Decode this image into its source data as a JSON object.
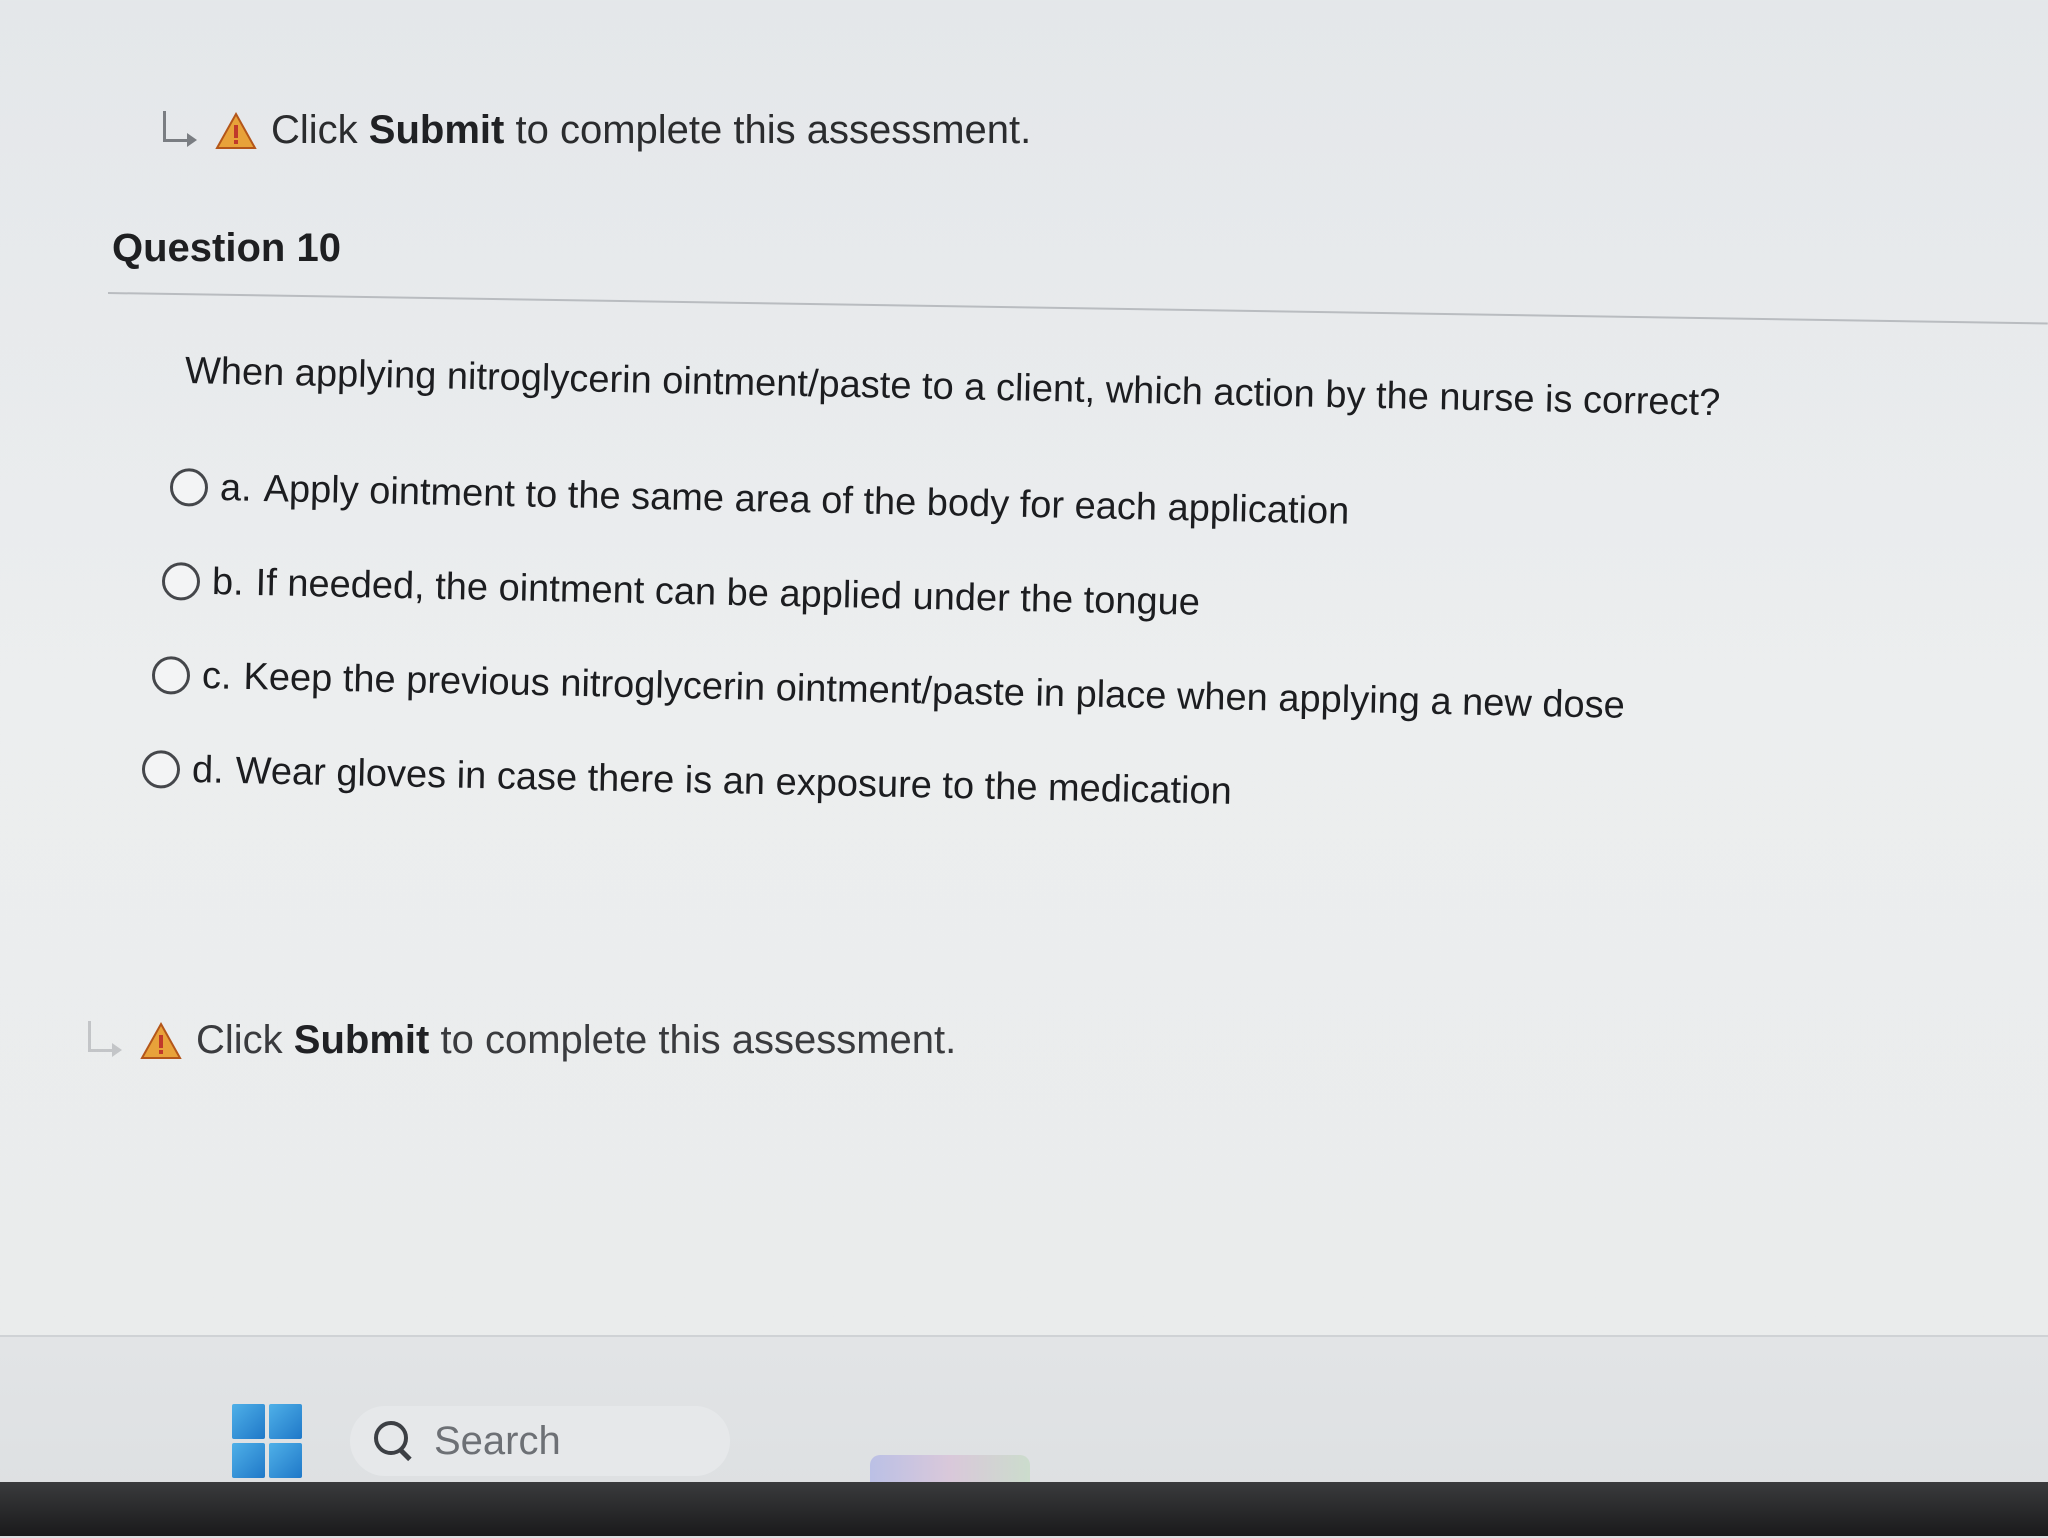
{
  "notice": {
    "prefix": "Click",
    "submit_word": "Submit",
    "suffix": "to complete this assessment."
  },
  "question": {
    "header": "Question 10",
    "text": "When applying nitroglycerin ointment/paste to a client, which action by the nurse is correct?",
    "options": [
      {
        "letter": "a.",
        "text": "Apply ointment to the same area of the body for each application",
        "selected": false
      },
      {
        "letter": "b.",
        "text": "If needed, the ointment can be applied under the tongue",
        "selected": false
      },
      {
        "letter": "c.",
        "text": "Keep the previous nitroglycerin ointment/paste in place when applying a new dose",
        "selected": false
      },
      {
        "letter": "d.",
        "text": "Wear gloves in case there is an exposure to the medication",
        "selected": false
      }
    ]
  },
  "taskbar": {
    "search_placeholder": "Search"
  },
  "colors": {
    "warning": "#e8a23a",
    "warning_mark": "#c0392b",
    "windows_logo": "#1f78c8"
  },
  "icons": {
    "redirect": "arrow-turn-right-icon",
    "warning": "warning-triangle-icon",
    "start": "windows-start-icon",
    "search": "search-icon"
  }
}
